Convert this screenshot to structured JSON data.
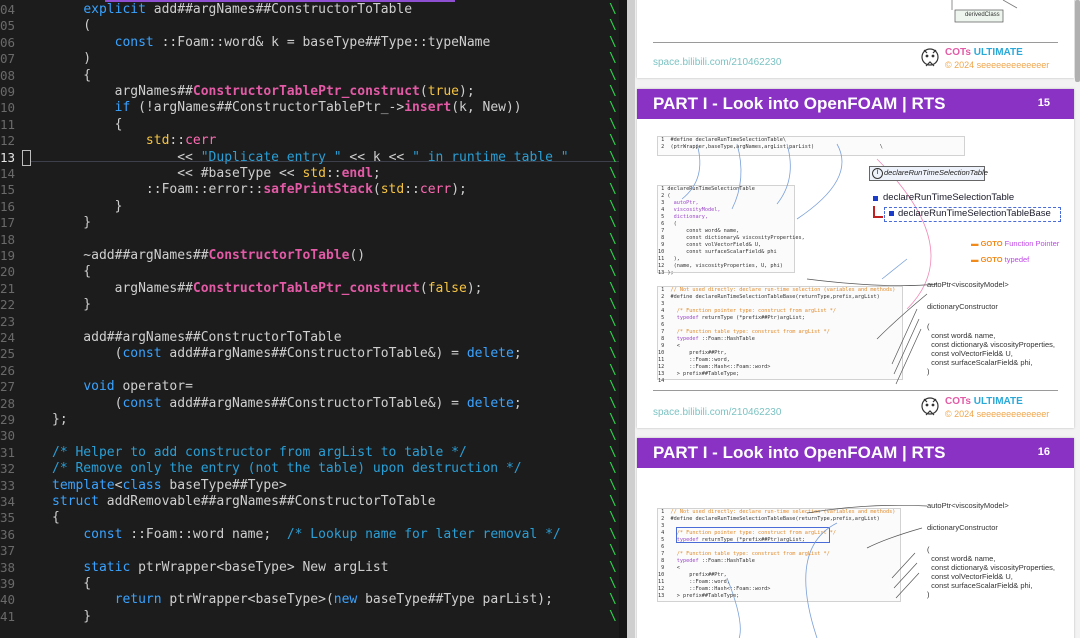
{
  "editor": {
    "line_numbers": [
      "04",
      "05",
      "06",
      "07",
      "08",
      "09",
      "10",
      "11",
      "12",
      "13",
      "14",
      "15",
      "16",
      "17",
      "18",
      "19",
      "20",
      "21",
      "22",
      "23",
      "24",
      "25",
      "26",
      "27",
      "28",
      "29",
      "30",
      "31",
      "32",
      "33",
      "34",
      "35",
      "36",
      "37",
      "38",
      "39",
      "40",
      "41"
    ],
    "current_line": "13"
  },
  "slides": {
    "prev": {
      "url": "space.bilibili.com/210462230",
      "brand": "COTs",
      "brand_suffix": "ULTIMATE",
      "copyright": "© 2024 seeeeeeeeeeeeer",
      "diagram_label": "derivedClass"
    },
    "s15": {
      "title": "PART I - Look into OpenFOAM | RTS",
      "number": "15",
      "label_box": "declareRunTimeSelectionTable",
      "bullet1": "declareRunTimeSelectionTable",
      "bullet2": "declareRunTimeSelectionTableBase",
      "goto1_prefix": "GOTO",
      "goto1": "Function Pointer",
      "goto2_prefix": "GOTO",
      "goto2": "typedef",
      "autoptr": "autoPtr<viscosityModel>",
      "dict": "dictionaryConstructor",
      "args": "(\n  const word& name,\n  const dictionary& viscosityProperties,\n  const volVectorField& U,\n  const surfaceScalarField& phi,\n)",
      "url": "space.bilibili.com/210462230",
      "brand": "COTs",
      "brand_suffix": "ULTIMATE",
      "copyright": "© 2024 seeeeeeeeeeeeer"
    },
    "s16": {
      "title": "PART I - Look into OpenFOAM | RTS",
      "number": "16",
      "autoptr": "autoPtr<viscosityModel>",
      "dict": "dictionaryConstructor",
      "args": "(\n  const word& name,\n  const dictionary& viscosityProperties,\n  const volVectorField& U,\n  const surfaceScalarField& phi,\n)"
    }
  },
  "colors": {
    "slide_header": "#8932c4",
    "editor_bg": "#1c1c1c",
    "keyword": "#3aa3ff",
    "function": "#e35aa6",
    "literal": "#f6c443",
    "comment": "#2a9fd6",
    "trailing_slash": "#2bd44b"
  }
}
